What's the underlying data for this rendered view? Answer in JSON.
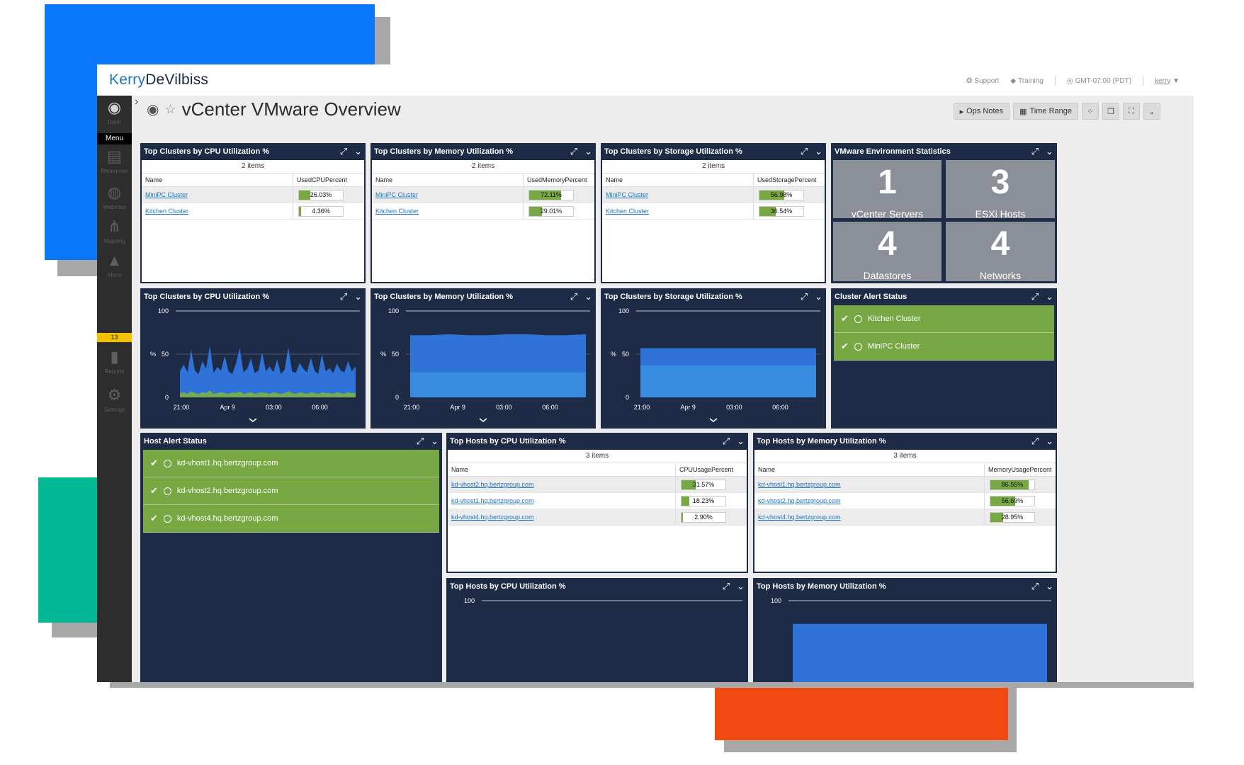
{
  "brand": {
    "part1": "Kerry",
    "part2": "DeVilbiss"
  },
  "topbar": {
    "support": "Support",
    "training": "Training",
    "timezone": "GMT-07:00 (PDT)",
    "user": "kerry"
  },
  "sidebar": {
    "items": [
      {
        "label": "Dash",
        "icon": "palette-icon"
      },
      {
        "label": "Resources",
        "icon": "server-icon"
      },
      {
        "label": "Websites",
        "icon": "globe-icon"
      },
      {
        "label": "Mapping",
        "icon": "mapping-icon"
      },
      {
        "label": "Alerts",
        "icon": "warning-icon"
      },
      {
        "label": "Reports",
        "icon": "report-icon"
      },
      {
        "label": "Settings",
        "icon": "gear-icon"
      }
    ],
    "menu_label": "Menu",
    "alert_count": "13"
  },
  "page": {
    "title": "vCenter VMware Overview"
  },
  "toolbar": {
    "ops_notes": "Ops Notes",
    "time_range": "Time Range"
  },
  "panels": {
    "cpu_table": {
      "title": "Top Clusters by CPU Utilization %",
      "items": "2 items",
      "col_name": "Name",
      "col_pct": "UsedCPUPercent",
      "rows": [
        {
          "name": "MiniPC Cluster",
          "pct": "26.03%",
          "val": 26.03
        },
        {
          "name": "Kitchen Cluster",
          "pct": "4.36%",
          "val": 4.36
        }
      ]
    },
    "mem_table": {
      "title": "Top Clusters by Memory Utilization %",
      "items": "2 items",
      "col_name": "Name",
      "col_pct": "UsedMemoryPercent",
      "rows": [
        {
          "name": "MiniPC Cluster",
          "pct": "72.11%",
          "val": 72.11
        },
        {
          "name": "Kitchen Cluster",
          "pct": "29.01%",
          "val": 29.01
        }
      ]
    },
    "sto_table": {
      "title": "Top Clusters by Storage Utilization %",
      "items": "2 items",
      "col_name": "Name",
      "col_pct": "UsedStoragePercent",
      "rows": [
        {
          "name": "MiniPC Cluster",
          "pct": "56.98%",
          "val": 56.98
        },
        {
          "name": "Kitchen Cluster",
          "pct": "36.54%",
          "val": 36.54
        }
      ]
    },
    "env_stats": {
      "title": "VMware Environment Statistics",
      "tiles": [
        {
          "num": "1",
          "label": "vCenter Servers"
        },
        {
          "num": "3",
          "label": "ESXi Hosts"
        },
        {
          "num": "4",
          "label": "Datastores"
        },
        {
          "num": "4",
          "label": "Networks"
        }
      ]
    },
    "cpu_chart": {
      "title": "Top Clusters by CPU Utilization %"
    },
    "mem_chart": {
      "title": "Top Clusters by Memory Utilization %"
    },
    "sto_chart": {
      "title": "Top Clusters by Storage Utilization %"
    },
    "cluster_alerts": {
      "title": "Cluster Alert Status",
      "rows": [
        "Kitchen Cluster",
        "MiniPC Cluster"
      ]
    },
    "host_alerts": {
      "title": "Host Alert Status",
      "rows": [
        "kd-vhost1.hq.bertzgroup.com",
        "kd-vhost2.hq.bertzgroup.com",
        "kd-vhost4.hq.bertzgroup.com"
      ]
    },
    "host_cpu_table": {
      "title": "Top Hosts by CPU Utilization %",
      "items": "3 items",
      "col_name": "Name",
      "col_pct": "CPUUsagePercent",
      "rows": [
        {
          "name": "kd-vhost2.hq.bertzgroup.com",
          "pct": "31.57%",
          "val": 31.57
        },
        {
          "name": "kd-vhost1.hq.bertzgroup.com",
          "pct": "18.23%",
          "val": 18.23
        },
        {
          "name": "kd-vhost4.hq.bertzgroup.com",
          "pct": "2.90%",
          "val": 2.9
        }
      ]
    },
    "host_mem_table": {
      "title": "Top Hosts by Memory Utilization %",
      "items": "3 items",
      "col_name": "Name",
      "col_pct": "MemoryUsagePercent",
      "rows": [
        {
          "name": "kd-vhost1.hq.bertzgroup.com",
          "pct": "86.55%",
          "val": 86.55
        },
        {
          "name": "kd-vhost2.hq.bertzgroup.com",
          "pct": "56.69%",
          "val": 56.69
        },
        {
          "name": "kd-vhost4.hq.bertzgroup.com",
          "pct": "28.95%",
          "val": 28.95
        }
      ]
    },
    "host_cpu_chart": {
      "title": "Top Hosts by CPU Utilization %"
    },
    "host_mem_chart": {
      "title": "Top Hosts by Memory Utilization %"
    }
  },
  "chart_data": [
    {
      "type": "area",
      "title": "Top Clusters by CPU Utilization %",
      "ylabel": "%",
      "ylim": [
        0,
        100
      ],
      "yticks": [
        "100",
        "50",
        "0"
      ],
      "xticks": [
        "21:00",
        "Apr 9",
        "03:00",
        "06:00"
      ],
      "series": [
        {
          "values": [
            30,
            38,
            29,
            55,
            31,
            27,
            42,
            33,
            60,
            28,
            35,
            31,
            48,
            30,
            27,
            39,
            57,
            29,
            33,
            45,
            28,
            31,
            52,
            30,
            36,
            29,
            44,
            27,
            32,
            58,
            30,
            28,
            40,
            33,
            29,
            46,
            31,
            27,
            50,
            30,
            34,
            28,
            39,
            31,
            29,
            42,
            30,
            36
          ]
        },
        {
          "values": [
            5,
            6,
            4,
            7,
            5,
            4,
            6,
            5,
            8,
            4,
            5,
            6,
            5,
            4,
            6,
            5,
            7,
            4,
            5,
            6,
            4,
            5,
            6,
            5,
            4,
            6,
            5,
            4,
            5,
            7,
            5,
            4,
            6,
            5,
            4,
            6,
            5,
            4,
            6,
            5,
            5,
            4,
            6,
            5,
            4,
            6,
            5,
            5
          ]
        }
      ]
    },
    {
      "type": "area",
      "title": "Top Clusters by Memory Utilization %",
      "ylabel": "%",
      "ylim": [
        0,
        100
      ],
      "yticks": [
        "100",
        "50",
        "0"
      ],
      "xticks": [
        "21:00",
        "Apr 9",
        "03:00",
        "06:00"
      ],
      "series": [
        {
          "values": [
            72,
            72,
            73,
            72,
            72,
            73,
            73,
            72,
            72,
            73
          ]
        },
        {
          "values": [
            29,
            29,
            29,
            29,
            29,
            29,
            29,
            29,
            29,
            29
          ]
        }
      ]
    },
    {
      "type": "area",
      "title": "Top Clusters by Storage Utilization %",
      "ylabel": "%",
      "ylim": [
        0,
        100
      ],
      "yticks": [
        "100",
        "50",
        "0"
      ],
      "xticks": [
        "21:00",
        "Apr 9",
        "03:00",
        "06:00"
      ],
      "series": [
        {
          "values": [
            57,
            57,
            57,
            57,
            57,
            57,
            57,
            57,
            57,
            57
          ]
        },
        {
          "values": [
            37,
            37,
            37,
            37,
            37,
            37,
            37,
            37,
            37,
            37
          ]
        }
      ]
    },
    {
      "type": "area",
      "title": "Top Hosts by CPU Utilization %",
      "ylim": [
        0,
        100
      ],
      "yticks": [
        "100"
      ],
      "series": []
    },
    {
      "type": "area",
      "title": "Top Hosts by Memory Utilization %",
      "ylim": [
        0,
        100
      ],
      "yticks": [
        "100"
      ],
      "series": [
        {
          "values": [
            87,
            87,
            87,
            87
          ]
        }
      ]
    }
  ]
}
